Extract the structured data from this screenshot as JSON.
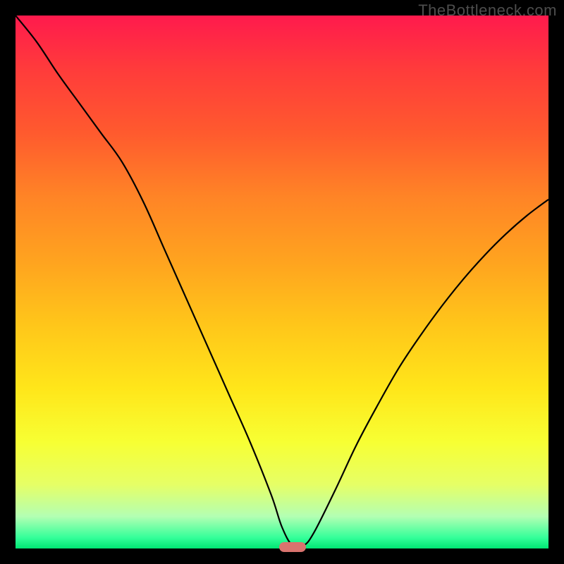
{
  "watermark": "TheBottleneck.com",
  "colors": {
    "frame_bg": "#000000",
    "curve_stroke": "#000000",
    "marker_fill": "#d9736e",
    "gradient_top": "#ff1a4d",
    "gradient_bottom": "#00e673"
  },
  "chart_data": {
    "type": "line",
    "title": "",
    "xlabel": "",
    "ylabel": "",
    "xlim": [
      0,
      100
    ],
    "ylim": [
      0,
      100
    ],
    "x": [
      0,
      4,
      8,
      12,
      16,
      20,
      24,
      28,
      32,
      36,
      40,
      44,
      48,
      50,
      52,
      54,
      56,
      60,
      64,
      68,
      72,
      76,
      80,
      84,
      88,
      92,
      96,
      100
    ],
    "values": [
      100,
      95,
      89,
      83.5,
      78,
      72.5,
      65,
      56,
      47,
      38,
      29,
      20,
      10,
      4,
      0.5,
      0.5,
      3,
      11,
      19.5,
      27,
      34,
      40,
      45.5,
      50.5,
      55,
      59,
      62.5,
      65.5
    ],
    "notch_x_range": [
      50,
      54
    ],
    "marker": {
      "x": 52,
      "y": 0
    },
    "grid": false,
    "legend": false
  }
}
